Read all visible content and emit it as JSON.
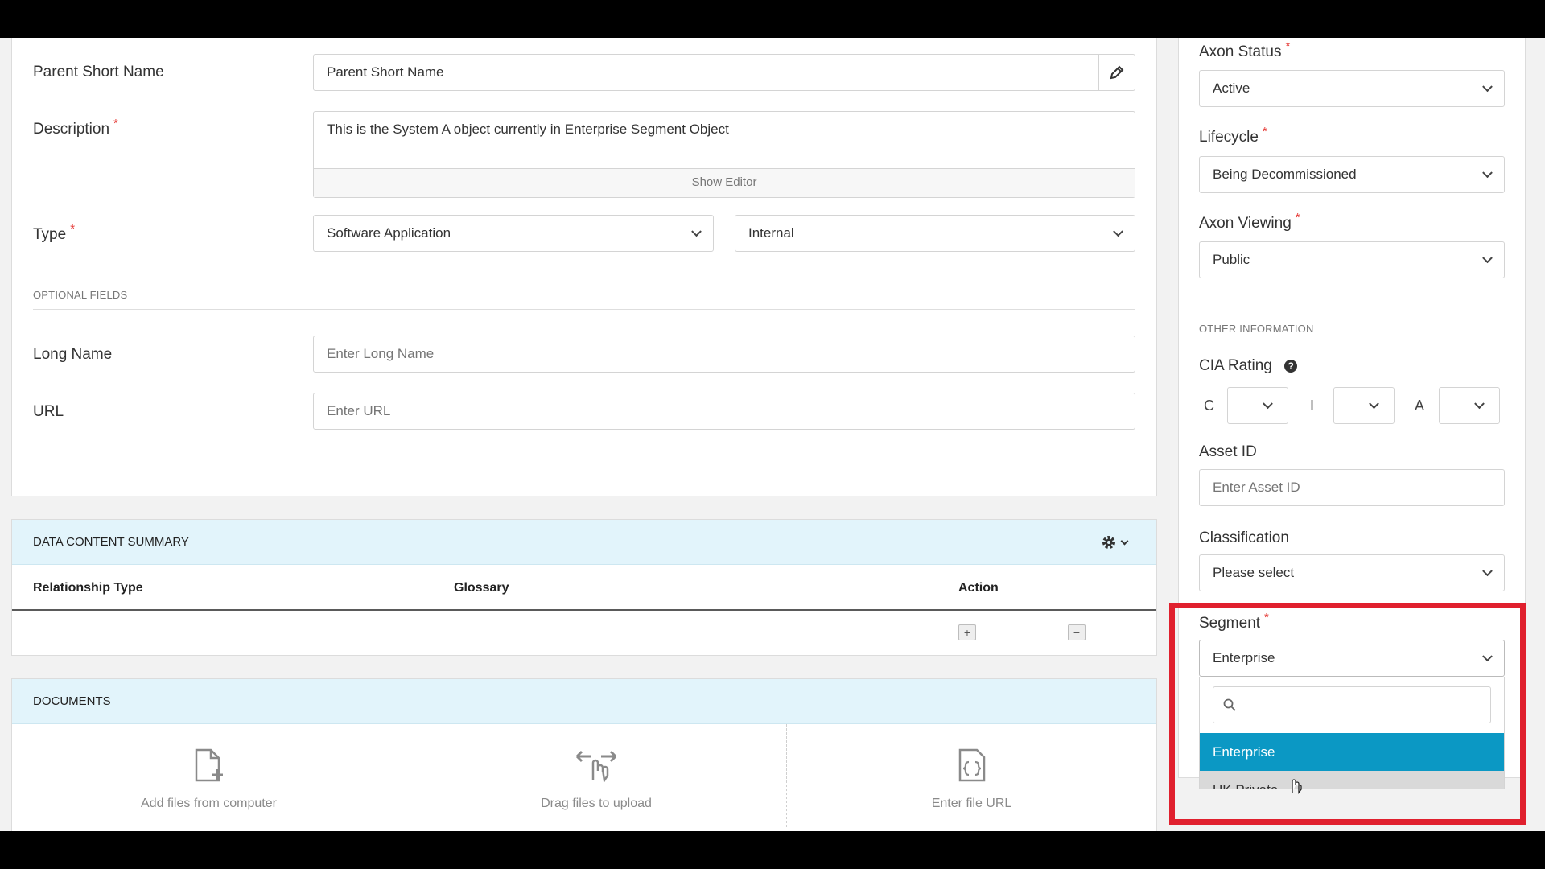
{
  "form": {
    "parent_short_name": {
      "label": "Parent Short Name",
      "value": "Parent Short Name"
    },
    "description": {
      "label": "Description",
      "value": "This is the System A object currently in Enterprise Segment Object",
      "show_editor": "Show Editor"
    },
    "type": {
      "label": "Type",
      "value1": "Software Application",
      "value2": "Internal"
    },
    "optional_fields_title": "OPTIONAL FIELDS",
    "long_name": {
      "label": "Long Name",
      "placeholder": "Enter Long Name"
    },
    "url": {
      "label": "URL",
      "placeholder": "Enter URL"
    }
  },
  "data_content": {
    "title": "DATA CONTENT SUMMARY",
    "columns": [
      "Relationship Type",
      "Glossary",
      "Action"
    ],
    "add_symbol": "+",
    "remove_symbol": "−"
  },
  "documents": {
    "title": "DOCUMENTS",
    "add_files": "Add files from computer",
    "drag_files": "Drag files to upload",
    "file_url": "Enter file URL"
  },
  "sidebar": {
    "axon_status": {
      "label": "Axon Status",
      "value": "Active"
    },
    "lifecycle": {
      "label": "Lifecycle",
      "value": "Being Decommissioned"
    },
    "axon_viewing": {
      "label": "Axon Viewing",
      "value": "Public"
    },
    "other_information_title": "OTHER INFORMATION",
    "cia": {
      "label": "CIA Rating",
      "c": "C",
      "i": "I",
      "a": "A"
    },
    "asset_id": {
      "label": "Asset ID",
      "placeholder": "Enter Asset ID"
    },
    "classification": {
      "label": "Classification",
      "value": "Please select"
    },
    "segment": {
      "label": "Segment",
      "value": "Enterprise",
      "options": [
        "Enterprise",
        "UK Private"
      ]
    }
  },
  "required_marker": "*",
  "colors": {
    "accent": "#0b98c4",
    "highlight_box": "#e0202e",
    "required": "#e53935",
    "section_header_bg": "#e2f4fb"
  }
}
